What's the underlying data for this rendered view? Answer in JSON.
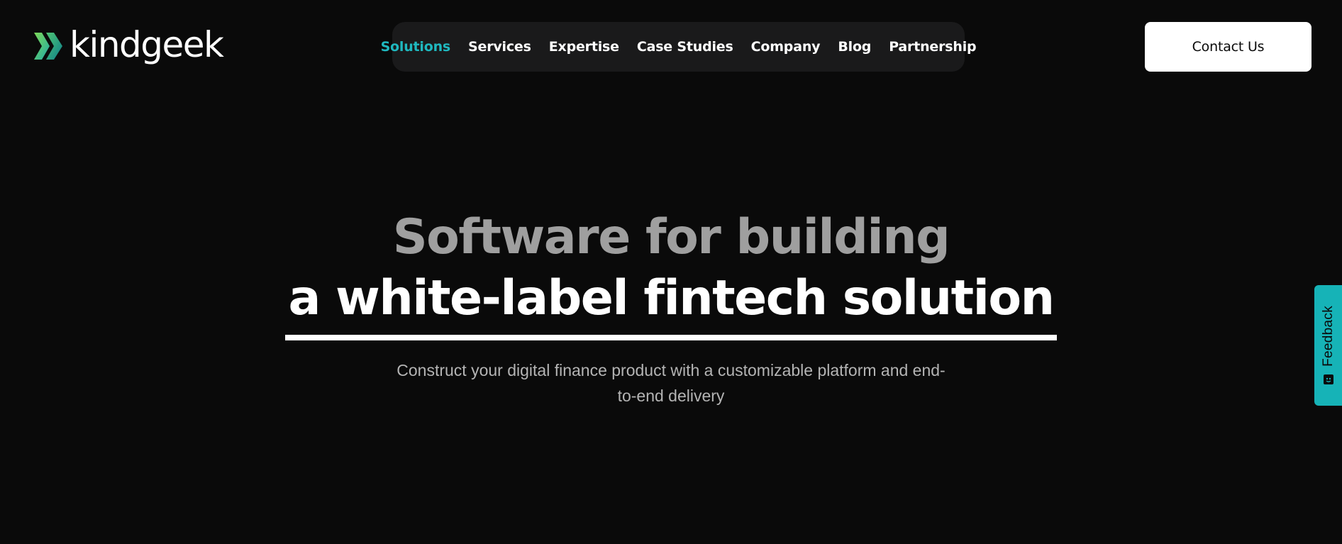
{
  "brand": {
    "name": "kindgeek",
    "colors": {
      "accent": "#1fb8bf",
      "mark_green": "#6fcf5a",
      "mark_teal": "#159aa0"
    }
  },
  "nav": {
    "items": [
      {
        "label": "Solutions",
        "active": true
      },
      {
        "label": "Services",
        "active": false
      },
      {
        "label": "Expertise",
        "active": false
      },
      {
        "label": "Case Studies",
        "active": false
      },
      {
        "label": "Company",
        "active": false
      },
      {
        "label": "Blog",
        "active": false
      },
      {
        "label": "Partnership",
        "active": false
      }
    ]
  },
  "header": {
    "contact_label": "Contact Us"
  },
  "hero": {
    "title_line1": "Software for building",
    "title_line2": "a white-label fintech solution",
    "subtitle": "Construct your digital finance product with a customizable platform and end-to-end delivery"
  },
  "feedback": {
    "label": "Feedback",
    "icon": "feedback-icon",
    "color": "#16b3b7"
  }
}
